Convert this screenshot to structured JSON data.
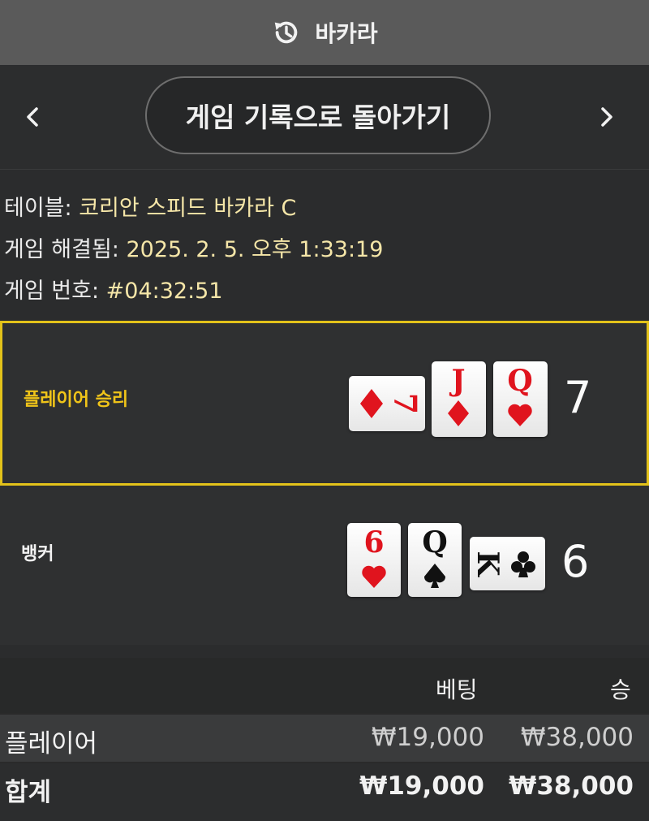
{
  "header": {
    "title": "바카라",
    "icon": "history-icon"
  },
  "nav": {
    "back_label": "게임 기록으로 돌아가기",
    "prev_icon": "chevron-left-icon",
    "next_icon": "chevron-right-icon"
  },
  "info": {
    "table_label": "테이블:",
    "table_value": "코리안 스피드 바카라 C",
    "resolved_label": "게임 해결됨:",
    "resolved_value": "2025. 2. 5. 오후 1:33:19",
    "round_label": "게임 번호:",
    "round_value": "#04:32:51"
  },
  "hands": {
    "player": {
      "label": "플레이어 승리",
      "score": "7",
      "cards": [
        {
          "rank": "7",
          "suit": "diamond",
          "orientation": "sideways"
        },
        {
          "rank": "J",
          "suit": "diamond",
          "orientation": "upright"
        },
        {
          "rank": "Q",
          "suit": "heart",
          "orientation": "upright"
        }
      ]
    },
    "banker": {
      "label": "뱅커",
      "score": "6",
      "cards": [
        {
          "rank": "6",
          "suit": "heart",
          "orientation": "upright"
        },
        {
          "rank": "Q",
          "suit": "spade",
          "orientation": "upright"
        },
        {
          "rank": "K",
          "suit": "club",
          "orientation": "sideways"
        }
      ]
    }
  },
  "bets": {
    "headers": {
      "bet": "베팅",
      "win": "승"
    },
    "rows": [
      {
        "label": "플레이어",
        "bet": "₩19,000",
        "win": "₩38,000"
      },
      {
        "label": "합계",
        "bet": "₩19,000",
        "win": "₩38,000"
      }
    ]
  },
  "colors": {
    "accent": "#e3c21a",
    "red_suit": "#e0141e",
    "black_suit": "#111111"
  }
}
